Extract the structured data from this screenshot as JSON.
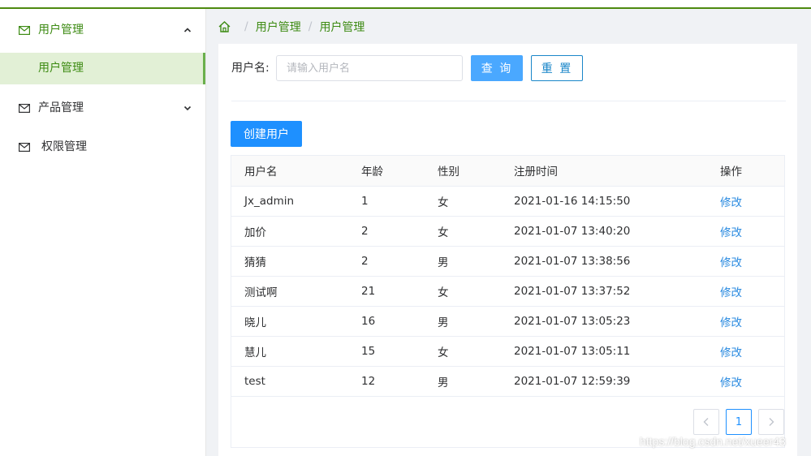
{
  "sidebar": {
    "menus": [
      {
        "label": "用户管理",
        "open": true,
        "sub": [
          {
            "label": "用户管理"
          }
        ]
      },
      {
        "label": "产品管理",
        "open": false
      },
      {
        "label": "权限管理"
      }
    ]
  },
  "breadcrumb": {
    "items": [
      "用户管理",
      "用户管理"
    ],
    "separator": "/"
  },
  "search": {
    "label": "用户名:",
    "placeholder": "请输入用户名",
    "value": "",
    "query_label": "查 询",
    "reset_label": "重 置"
  },
  "create_label": "创建用户",
  "table": {
    "columns": [
      "用户名",
      "年龄",
      "性别",
      "注册时间",
      "操作"
    ],
    "rows": [
      [
        "Jx_admin",
        "1",
        "女",
        "2021-01-16 14:15:50",
        "修改"
      ],
      [
        "加价",
        "2",
        "女",
        "2021-01-07 13:40:20",
        "修改"
      ],
      [
        "猜猜",
        "2",
        "男",
        "2021-01-07 13:38:56",
        "修改"
      ],
      [
        "测试啊",
        "21",
        "女",
        "2021-01-07 13:37:52",
        "修改"
      ],
      [
        "晓儿",
        "16",
        "男",
        "2021-01-07 13:05:23",
        "修改"
      ],
      [
        "慧儿",
        "15",
        "女",
        "2021-01-07 13:05:11",
        "修改"
      ],
      [
        "test",
        "12",
        "男",
        "2021-01-07 12:59:39",
        "修改"
      ]
    ]
  },
  "pagination": {
    "current": "1"
  },
  "watermark": "https://blog.csdn.net/xueer43",
  "colors": {
    "accent": "#3d8b13",
    "primary": "#1e90ff",
    "link": "#2b8be0"
  }
}
